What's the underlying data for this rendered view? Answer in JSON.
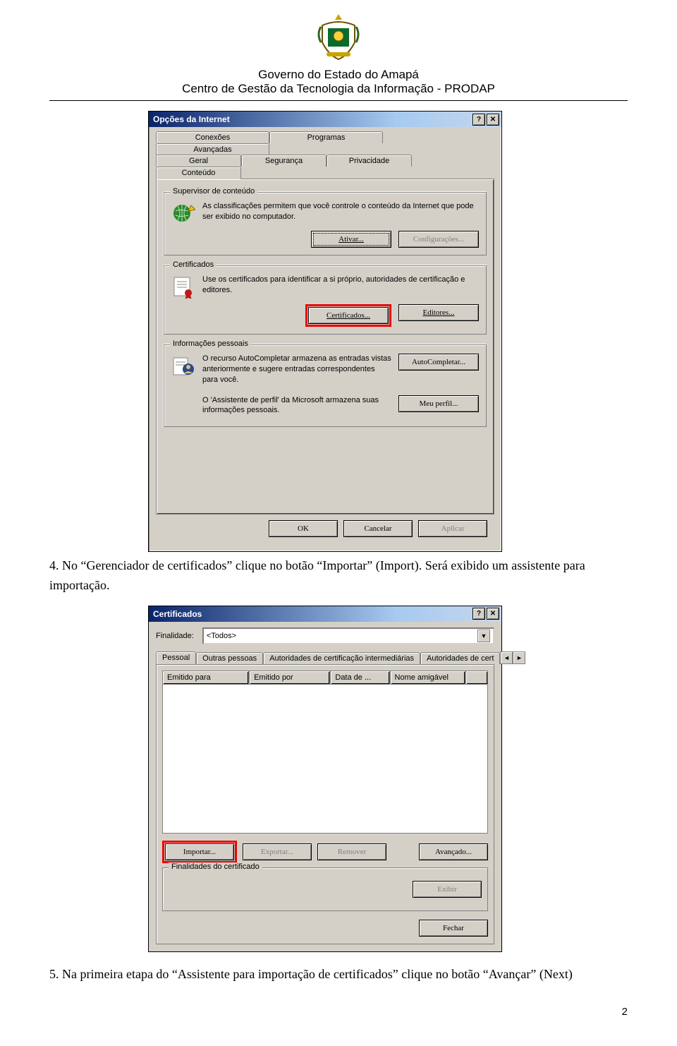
{
  "header": {
    "line1": "Governo do Estado do Amapá",
    "line2": "Centro de Gestão da Tecnologia da Informação - PRODAP"
  },
  "steps": {
    "s4": "4. No “Gerenciador de certificados” clique no botão “Importar” (Import). Será exibido um assistente para importação.",
    "s5": "5. Na primeira etapa do “Assistente para importação de certificados” clique no botão “Avançar” (Next)"
  },
  "dialog1": {
    "title": "Opções da Internet",
    "help": "?",
    "close": "✕",
    "tabsTop": [
      "Conexões",
      "Programas",
      "Avançadas"
    ],
    "tabsBottom": [
      "Geral",
      "Segurança",
      "Privacidade",
      "Conteúdo"
    ],
    "supervisor": {
      "legend": "Supervisor de conteúdo",
      "text": "As classificações permitem que você controle o conteúdo da Internet que pode ser exibido no computador.",
      "btnEnable": "Ativar...",
      "btnSettings": "Configurações..."
    },
    "certs": {
      "legend": "Certificados",
      "text": "Use os certificados para identificar a si próprio, autoridades de certificação e editores.",
      "btnCerts": "Certificados...",
      "btnPub": "Editores..."
    },
    "personal": {
      "legend": "Informações pessoais",
      "text1": "O recurso AutoCompletar armazena as entradas vistas anteriormente e sugere entradas correspondentes para você.",
      "btnAC": "AutoCompletar...",
      "text2": "O 'Assistente de perfil' da Microsoft armazena suas informações pessoais.",
      "btnProfile": "Meu perfil..."
    },
    "footer": {
      "ok": "OK",
      "cancel": "Cancelar",
      "apply": "Aplicar"
    }
  },
  "dialog2": {
    "title": "Certificados",
    "help": "?",
    "close": "✕",
    "purposeLabel": "Finalidade:",
    "purposeValue": "<Todos>",
    "tabs": [
      "Pessoal",
      "Outras pessoas",
      "Autoridades de certificação intermediárias",
      "Autoridades de cert"
    ],
    "cols": [
      "Emitido para",
      "Emitido por",
      "Data de ...",
      "Nome amigável"
    ],
    "btnImport": "Importar...",
    "btnExport": "Exportar...",
    "btnRemove": "Remover",
    "btnAdvanced": "Avançado...",
    "gbLegend": "Finalidades do certificado",
    "btnView": "Exibir",
    "btnClose": "Fechar"
  },
  "pagenum": "2"
}
